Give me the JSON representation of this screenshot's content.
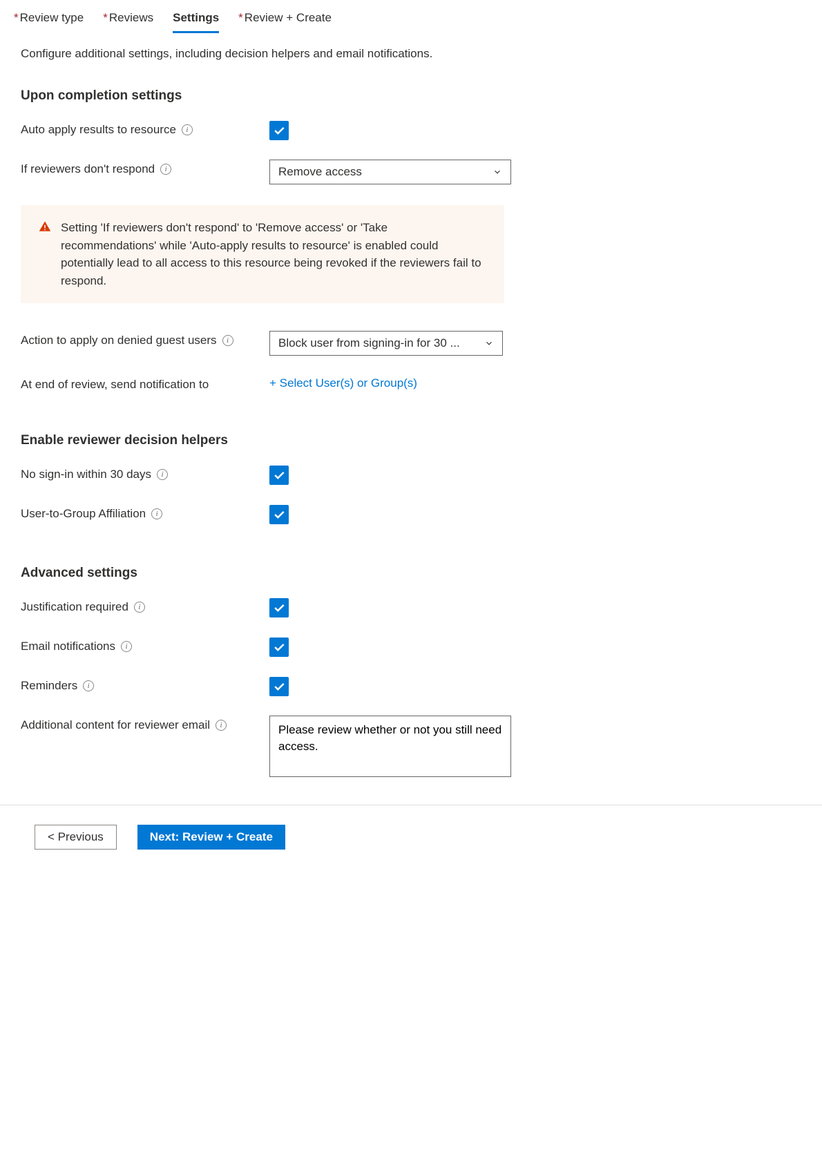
{
  "tabs": [
    {
      "label": "Review type",
      "required": true,
      "active": false
    },
    {
      "label": "Reviews",
      "required": true,
      "active": false
    },
    {
      "label": "Settings",
      "required": false,
      "active": true
    },
    {
      "label": "Review + Create",
      "required": true,
      "active": false
    }
  ],
  "description": "Configure additional settings, including decision helpers and email notifications.",
  "sections": {
    "completion": {
      "title": "Upon completion settings",
      "auto_apply_label": "Auto apply results to resource",
      "if_no_respond_label": "If reviewers don't respond",
      "if_no_respond_value": "Remove access",
      "warning_text": "Setting 'If reviewers don't respond' to 'Remove access' or 'Take recommendations' while 'Auto-apply results to resource' is enabled could potentially lead to all access to this resource being revoked if the reviewers fail to respond.",
      "denied_guest_label": "Action to apply on denied guest users",
      "denied_guest_value": "Block user from signing-in for 30 ...",
      "notify_label": "At end of review, send notification to",
      "notify_select_link": "+ Select User(s) or Group(s)"
    },
    "helpers": {
      "title": "Enable reviewer decision helpers",
      "no_signin_label": "No sign-in within 30 days",
      "affiliation_label": "User-to-Group Affiliation"
    },
    "advanced": {
      "title": "Advanced settings",
      "justification_label": "Justification required",
      "email_label": "Email notifications",
      "reminders_label": "Reminders",
      "additional_content_label": "Additional content for reviewer email",
      "additional_content_value": "Please review whether or not you still need access."
    }
  },
  "footer": {
    "previous": "< Previous",
    "next": "Next: Review + Create"
  }
}
